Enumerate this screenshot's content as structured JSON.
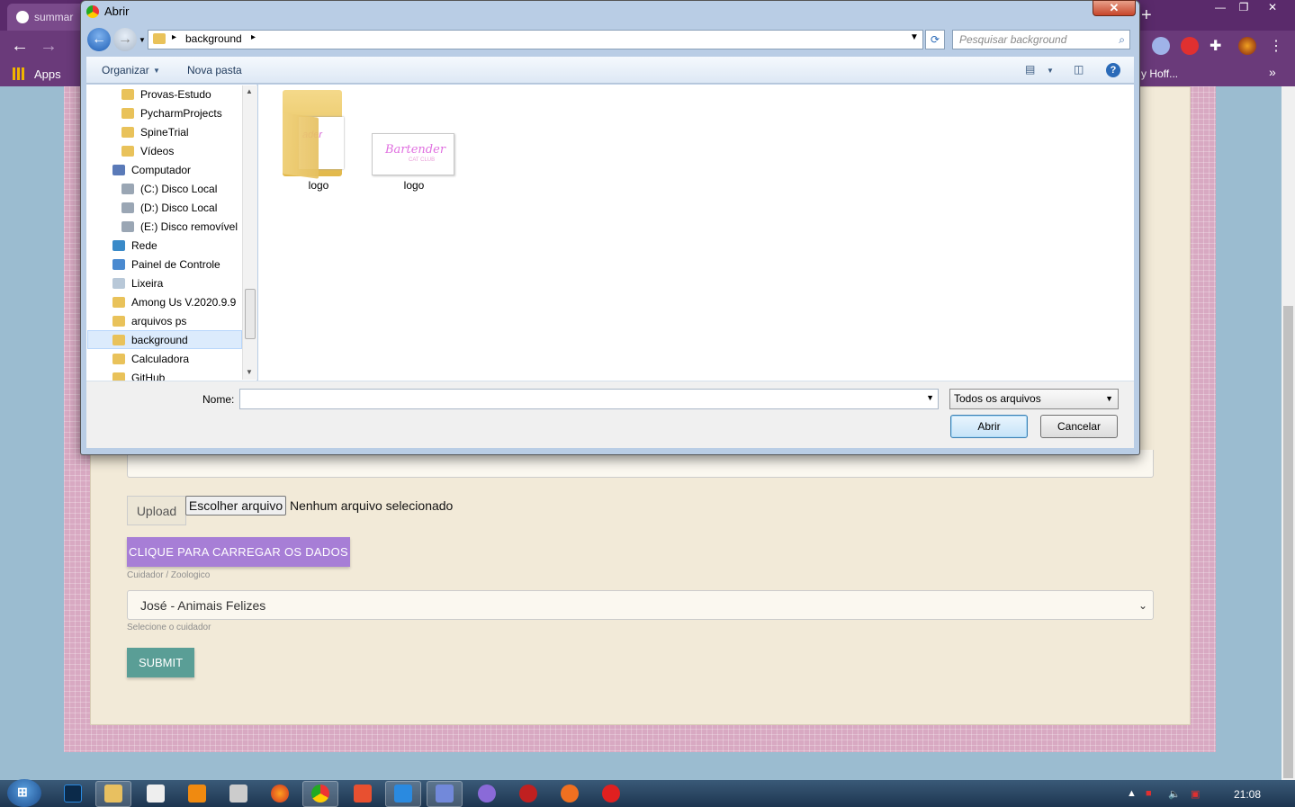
{
  "browser": {
    "tabs": [
      "summar"
    ],
    "bookmarks": {
      "apps_label": "Apps",
      "right_label": "y Hoff...",
      "overflow": "»"
    },
    "nav": {
      "back": "←",
      "forward": "→",
      "reload": "C"
    },
    "new_tab": "+",
    "window_controls": [
      "—",
      "❐",
      "✕"
    ]
  },
  "page": {
    "upload_label": "Upload",
    "file_button": "Escolher arquivo",
    "file_status": "Nenhum arquivo selecionado",
    "load_button": "CLIQUE PARA CARREGAR OS DADOS",
    "caretaker_label": "Cuidador / Zoologico",
    "caretaker_value": "José - Animais Felizes",
    "caretaker_help": "Selecione o cuidador",
    "submit_button": "SUBMIT"
  },
  "dialog": {
    "title": "Abrir",
    "close": "✕",
    "path": "background",
    "search_placeholder": "Pesquisar background",
    "commands": {
      "organize": "Organizar",
      "new_folder": "Nova pasta"
    },
    "nav_items": [
      {
        "label": "Provas-Estudo",
        "type": "folder"
      },
      {
        "label": "PycharmProjects",
        "type": "folder"
      },
      {
        "label": "SpineTrial",
        "type": "folder"
      },
      {
        "label": "Vídeos",
        "type": "folder"
      },
      {
        "label": "Computador",
        "type": "computer"
      },
      {
        "label": "(C:) Disco Local",
        "type": "drive"
      },
      {
        "label": "(D:) Disco Local",
        "type": "drive"
      },
      {
        "label": "(E:) Disco removível",
        "type": "drive"
      },
      {
        "label": "Rede",
        "type": "network"
      },
      {
        "label": "Painel de Controle",
        "type": "control"
      },
      {
        "label": "Lixeira",
        "type": "trash"
      },
      {
        "label": "Among Us V.2020.9.9",
        "type": "folder"
      },
      {
        "label": "arquivos ps",
        "type": "folder"
      },
      {
        "label": "background",
        "type": "folder",
        "selected": true
      },
      {
        "label": "Calculadora",
        "type": "folder"
      },
      {
        "label": "GitHub",
        "type": "folder"
      }
    ],
    "files": [
      {
        "label": "logo",
        "type": "folder"
      },
      {
        "label": "logo",
        "type": "image"
      }
    ],
    "thumb_text": "Bartender",
    "thumb_sub": "CAT CLUB",
    "name_label": "Nome:",
    "name_value": "",
    "filetype": "Todos os arquivos",
    "open_button": "Abrir",
    "cancel_button": "Cancelar"
  },
  "taskbar": {
    "clock": "21:08"
  },
  "colors": {
    "accent_purple": "#a77ed6",
    "submit_teal": "#5a9e96",
    "page_bg": "#f2ead8"
  }
}
